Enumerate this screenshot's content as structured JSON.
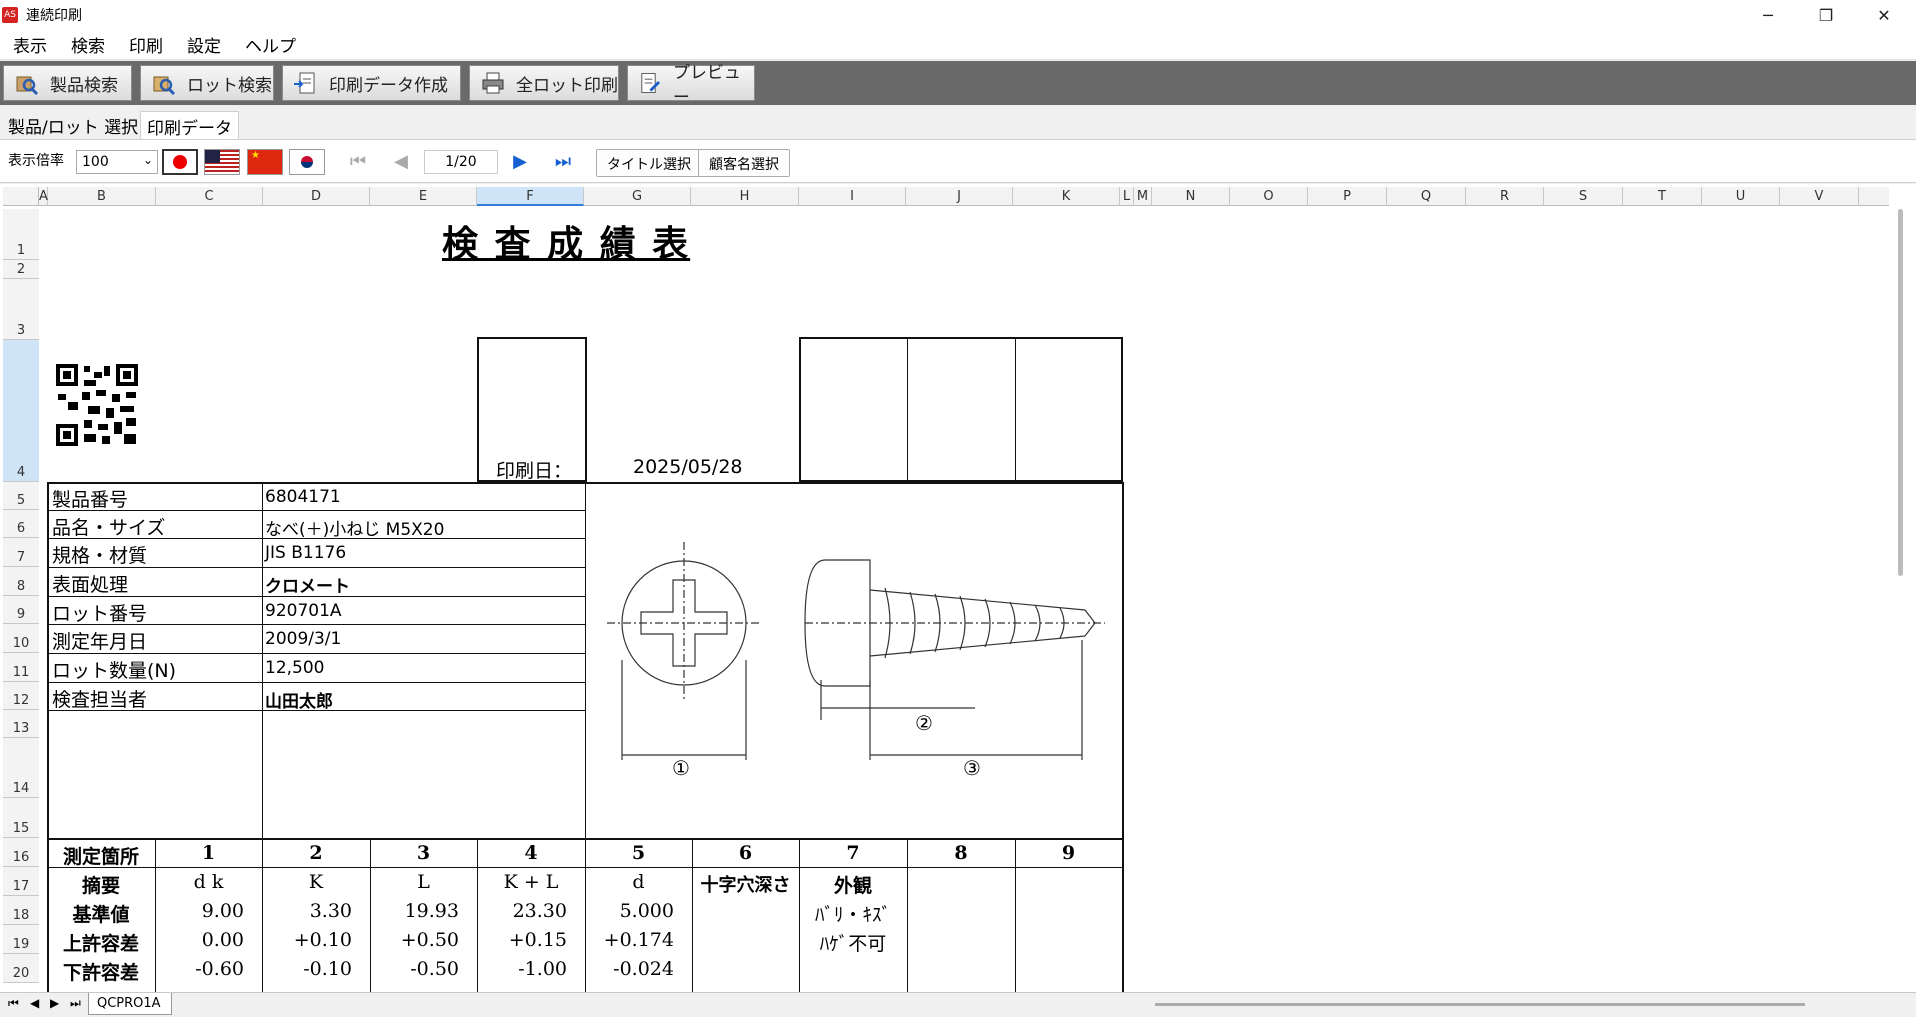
{
  "window": {
    "title": "連続印刷",
    "app_icon": "app-icon",
    "controls": [
      "minimize",
      "restore",
      "close"
    ]
  },
  "menu": [
    "表示",
    "検索",
    "印刷",
    "設定",
    "ヘルプ"
  ],
  "toolbar": [
    {
      "label": "製品検索",
      "icon": "product-search-icon"
    },
    {
      "label": "ロット検索",
      "icon": "lot-search-icon"
    },
    {
      "label": "印刷データ作成",
      "icon": "create-print-data-icon"
    },
    {
      "label": "全ロット印刷",
      "icon": "printer-icon"
    },
    {
      "label": "プレビュー",
      "icon": "preview-icon"
    }
  ],
  "tabs": [
    "製品/ロット 選択",
    "印刷データ"
  ],
  "active_tab": 1,
  "view": {
    "zoom_label": "表示倍率",
    "zoom_value": "100",
    "flags": [
      "japan",
      "usa",
      "china",
      "korea"
    ],
    "page": "1/20",
    "title_select": "タイトル選択",
    "customer_select": "顧客名選択"
  },
  "columns": [
    "A",
    "B",
    "C",
    "D",
    "E",
    "F",
    "G",
    "H",
    "I",
    "J",
    "K",
    "L",
    "M",
    "N",
    "O",
    "P",
    "Q",
    "R",
    "S",
    "T",
    "U",
    "V"
  ],
  "selected_column": "F",
  "rows": [
    "1",
    "2",
    "3",
    "4",
    "5",
    "6",
    "7",
    "8",
    "9",
    "10",
    "11",
    "12",
    "13",
    "14",
    "15",
    "16",
    "17",
    "18",
    "19",
    "20"
  ],
  "selected_row": "4",
  "report": {
    "title": "検 査 成 績 表",
    "print_date_label": "印刷日：",
    "print_date": "2025/05/28",
    "info": [
      {
        "label": "製品番号",
        "value": "6804171"
      },
      {
        "label": "品名・サイズ",
        "value": "なべ(＋)小ねじ M5X20"
      },
      {
        "label": "規格・材質",
        "value": "JIS B1176"
      },
      {
        "label": "表面処理",
        "value": "クロメート"
      },
      {
        "label": "ロット番号",
        "value": "920701A"
      },
      {
        "label": "測定年月日",
        "value": "2009/3/1"
      },
      {
        "label": "ロット数量(N)",
        "value": "12,500"
      },
      {
        "label": "検査担当者",
        "value": "山田太郎"
      }
    ],
    "diagram_labels": [
      "①",
      "②",
      "③"
    ],
    "measure_header": [
      "測定箇所",
      "1",
      "2",
      "3",
      "4",
      "5",
      "6",
      "7",
      "8",
      "9"
    ],
    "summary_row": [
      "摘要",
      "d k",
      "K",
      "L",
      "K + L",
      "d",
      "十字穴深さ",
      "外観",
      "",
      ""
    ],
    "standard_row": [
      "基準値",
      "9.00",
      "3.30",
      "19.93",
      "23.30",
      "5.000",
      "",
      "ﾊﾞﾘ・ｷｽﾞ",
      "",
      ""
    ],
    "upper_row": [
      "上許容差",
      "0.00",
      "+0.10",
      "+0.50",
      "+0.15",
      "+0.174",
      "",
      "ﾊｹﾞ不可",
      "",
      ""
    ],
    "lower_row": [
      "下許容差",
      "-0.60",
      "-0.10",
      "-0.50",
      "-1.00",
      "-0.024",
      "",
      "",
      "",
      ""
    ]
  },
  "sheet_tab": "QCPRO1A",
  "colors": {
    "toolbar_bg": "#6a6a6a",
    "selection": "#cfe4f7",
    "accent": "#2f7ed8"
  }
}
